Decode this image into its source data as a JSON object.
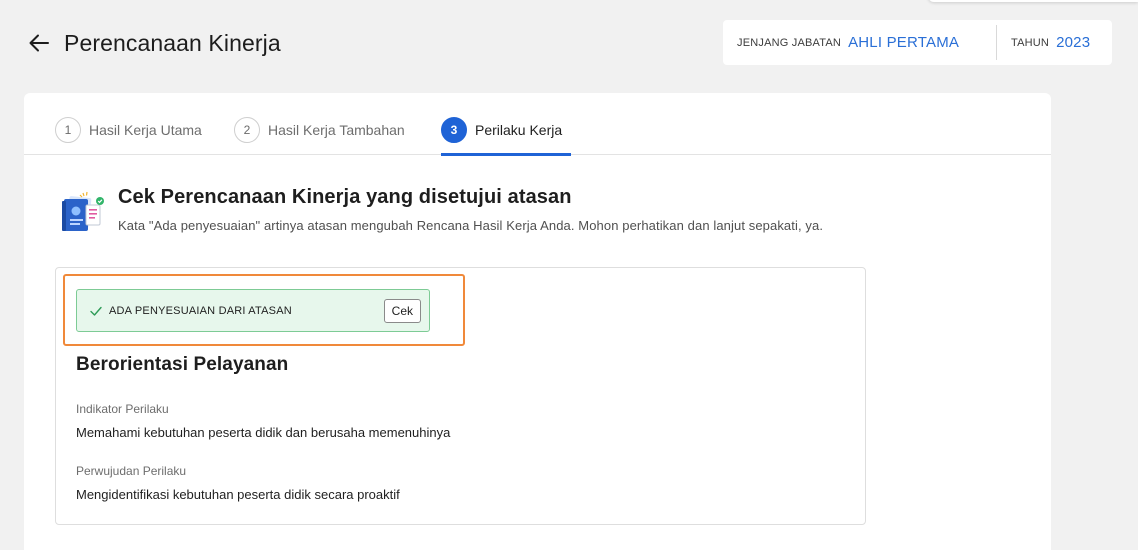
{
  "header": {
    "title": "Perencanaan Kinerja"
  },
  "info": {
    "jenjang_label": "JENJANG JABATAN",
    "jenjang_value": "AHLI PERTAMA",
    "tahun_label": "TAHUN",
    "tahun_value": "2023"
  },
  "tabs": [
    {
      "number": "1",
      "label": "Hasil Kerja Utama",
      "active": false
    },
    {
      "number": "2",
      "label": "Hasil Kerja Tambahan",
      "active": false
    },
    {
      "number": "3",
      "label": "Perilaku Kerja",
      "active": true
    }
  ],
  "notice": {
    "title": "Cek Perencanaan Kinerja yang disetujui atasan",
    "description": "Kata \"Ada penyesuaian\" artinya atasan mengubah Rencana Hasil Kerja Anda. Mohon perhatikan dan lanjut sepakati, ya."
  },
  "item": {
    "status_text": "ADA PENYESUAIAN DARI ATASAN",
    "cek_label": "Cek",
    "section_title": "Berorientasi Pelayanan",
    "indikator_label": "Indikator Perilaku",
    "indikator_value": "Memahami kebutuhan peserta didik dan berusaha memenuhinya",
    "perwujudan_label": "Perwujudan Perilaku",
    "perwujudan_value": "Mengidentifikasi kebutuhan peserta didik secara proaktif"
  },
  "colors": {
    "accent": "#1f63d6",
    "info_value": "#2a6fd6",
    "highlight": "#f0893a",
    "status_bg": "#e7f7ec",
    "status_border": "#7dcb95"
  },
  "icons": {
    "back": "arrow-left-icon",
    "notice": "document-check-icon",
    "status": "check-icon"
  }
}
